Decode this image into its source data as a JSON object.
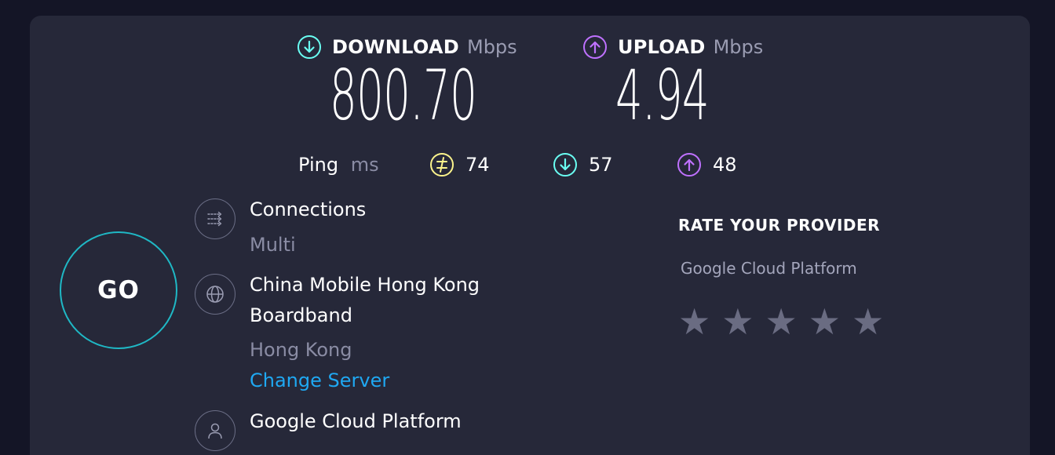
{
  "download": {
    "label": "DOWNLOAD",
    "unit": "Mbps",
    "value": "800.70"
  },
  "upload": {
    "label": "UPLOAD",
    "unit": "Mbps",
    "value": "4.94"
  },
  "ping": {
    "label": "Ping",
    "unit": "ms",
    "idle": "74",
    "download": "57",
    "upload": "48"
  },
  "go_button": {
    "label": "GO"
  },
  "connections": {
    "title": "Connections",
    "value": "Multi"
  },
  "server": {
    "name_line1": "China Mobile Hong Kong",
    "name_line2": "Boardband",
    "location": "Hong Kong",
    "change_label": "Change Server"
  },
  "provider": {
    "name": "Google Cloud Platform"
  },
  "rate": {
    "title": "RATE YOUR PROVIDER",
    "provider": "Google Cloud Platform",
    "stars": [
      "★",
      "★",
      "★",
      "★",
      "★"
    ],
    "rating": 0
  },
  "colors": {
    "background": "#141526",
    "panel": "#262839",
    "download_accent": "#6afff3",
    "upload_accent": "#bf71ff",
    "idle_accent": "#fbf38c",
    "go_ring": "#1fb8c5",
    "link": "#1fa8f2"
  },
  "icons": {
    "download": "download-arrow-icon",
    "upload": "upload-arrow-icon",
    "idle": "idle-ping-icon",
    "connections": "connections-icon",
    "server": "globe-icon",
    "provider": "user-icon"
  }
}
